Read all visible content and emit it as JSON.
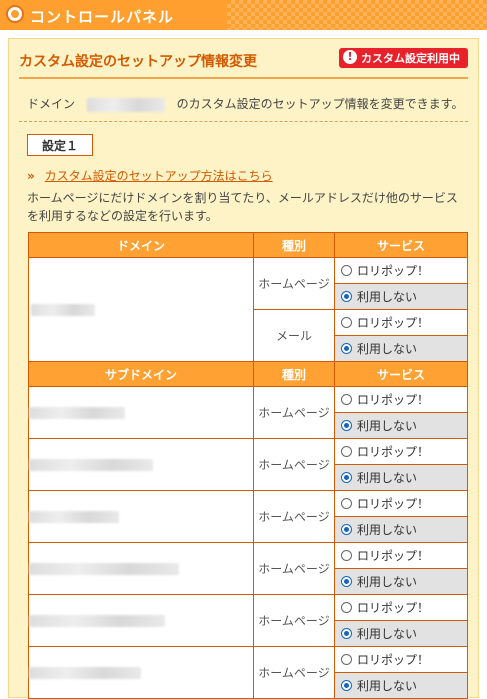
{
  "header": {
    "title": "コントロールパネル"
  },
  "section": {
    "title": "カスタム設定のセットアップ情報変更",
    "badge": "カスタム設定利用中",
    "desc_prefix": "ドメイン",
    "desc_suffix": "のカスタム設定のセットアップ情報を変更できます。",
    "tab": "設定１",
    "howto_link": "カスタム設定のセットアップ方法はこちら",
    "intro": "ホームページにだけドメインを割り当てたり、メールアドレスだけ他のサービスを利用するなどの設定を行います。"
  },
  "table": {
    "domain_headers": [
      "ドメイン",
      "種別",
      "サービス"
    ],
    "subdomain_headers": [
      "サブドメイン",
      "種別",
      "サービス"
    ],
    "domain_rows": [
      {
        "kind": "ホームページ",
        "options": [
          "ロリポップ！",
          "利用しない"
        ],
        "selected": 1
      },
      {
        "kind": "メール",
        "options": [
          "ロリポップ！",
          "利用しない"
        ],
        "selected": 1
      }
    ],
    "subdomain_rows": [
      {
        "kind": "ホームページ",
        "options": [
          "ロリポップ！",
          "利用しない"
        ],
        "selected": 1
      },
      {
        "kind": "ホームページ",
        "options": [
          "ロリポップ！",
          "利用しない"
        ],
        "selected": 1
      },
      {
        "kind": "ホームページ",
        "options": [
          "ロリポップ！",
          "利用しない"
        ],
        "selected": 1
      },
      {
        "kind": "ホームページ",
        "options": [
          "ロリポップ！",
          "利用しない"
        ],
        "selected": 1
      },
      {
        "kind": "ホームページ",
        "options": [
          "ロリポップ！",
          "利用しない"
        ],
        "selected": 1
      },
      {
        "kind": "ホームページ",
        "options": [
          "ロリポップ！",
          "利用しない"
        ],
        "selected": 1
      }
    ]
  },
  "colors": {
    "accent": "#ff9f2f",
    "title": "#d35a00",
    "badge": "#e8212b",
    "panel": "#fdf3c7"
  }
}
